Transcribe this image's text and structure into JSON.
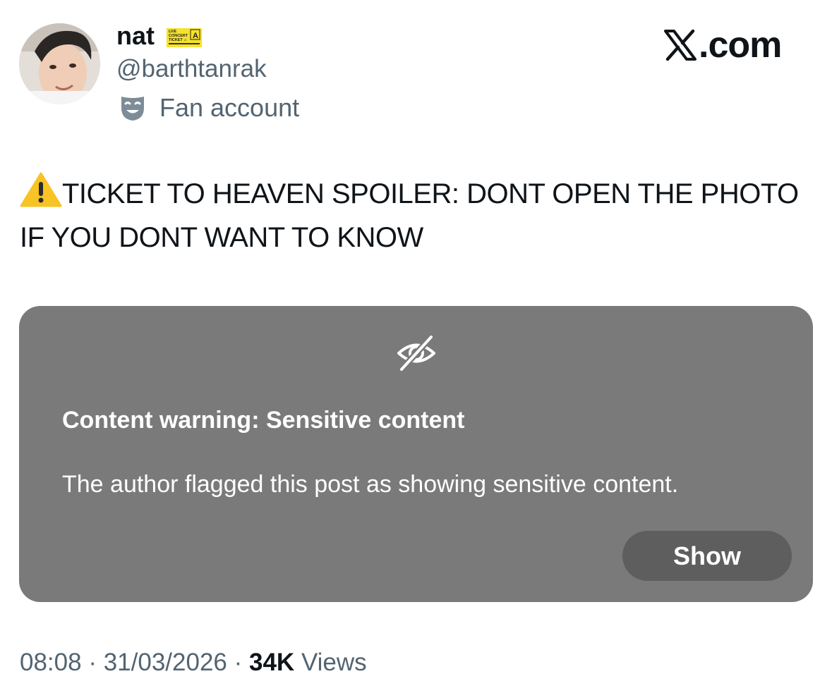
{
  "author": {
    "display_name": "nat",
    "handle": "@barthtanrak",
    "label": "Fan account",
    "avatar_icon": "avatar-photo",
    "badge_icon": "concert-ticket-badge-icon",
    "badge_text": {
      "line1": "LIVE",
      "line2": "CONCERT",
      "line3": "TICKET ♫",
      "seat": "A"
    },
    "label_icon": "theater-mask-icon"
  },
  "brand": {
    "site": ".com",
    "logo_icon": "x-logo-icon"
  },
  "post": {
    "text": "TICKET TO HEAVEN SPOILER: DONT OPEN THE PHOTO IF YOU DONT WANT TO KNOW",
    "leading_icon": "warning-icon"
  },
  "media_warning": {
    "icon": "eye-slash-icon",
    "title": "Content warning: Sensitive content",
    "body": "The author flagged this post as showing sensitive content.",
    "button_label": "Show"
  },
  "meta": {
    "time": "08:08",
    "separator": " · ",
    "date": "31/03/2026",
    "views_count": "34K",
    "views_label": "Views"
  },
  "colors": {
    "text_primary": "#0f1419",
    "text_secondary": "#536471",
    "card_bg": "#7a7a7a",
    "button_bg": "#5e5e5e",
    "badge_yellow": "#f5e22a"
  }
}
